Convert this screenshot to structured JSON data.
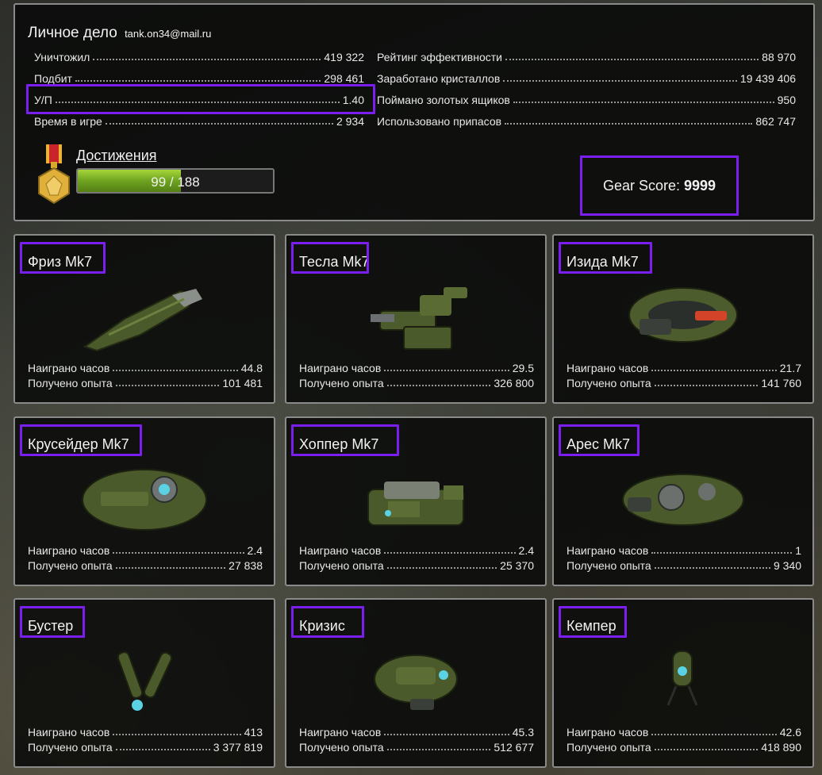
{
  "profile": {
    "title": "Личное дело",
    "email": "tank.on34@mail.ru",
    "left_stats": [
      {
        "label": "Уничтожил",
        "value": "419 322"
      },
      {
        "label": "Подбит",
        "value": "298 461"
      },
      {
        "label": "У/П",
        "value": "1.40"
      },
      {
        "label": "Время в игре",
        "value": "2 934"
      }
    ],
    "right_stats": [
      {
        "label": "Рейтинг эффективности",
        "value": "88 970"
      },
      {
        "label": "Заработано кристаллов",
        "value": "19 439 406"
      },
      {
        "label": "Поймано золотых ящиков",
        "value": "950"
      },
      {
        "label": "Использовано припасов",
        "value": "862 747"
      }
    ],
    "achievements": {
      "label": "Достижения",
      "progress_text": "99 / 188",
      "progress_fraction": 0.527
    },
    "gear_score": {
      "label": "Gear Score:",
      "value": "9999"
    }
  },
  "cards": [
    {
      "name": "Фриз Mk7",
      "hours_label": "Наиграно часов",
      "hours": "44.8",
      "xp_label": "Получено опыта",
      "xp": "101 481",
      "icon": "freeze-turret-icon"
    },
    {
      "name": "Тесла Mk7",
      "hours_label": "Наиграно часов",
      "hours": "29.5",
      "xp_label": "Получено опыта",
      "xp": "326 800",
      "icon": "tesla-turret-icon"
    },
    {
      "name": "Изида Mk7",
      "hours_label": "Наиграно часов",
      "hours": "21.7",
      "xp_label": "Получено опыта",
      "xp": "141 760",
      "icon": "isida-turret-icon"
    },
    {
      "name": "Крусейдер Mk7",
      "hours_label": "Наиграно часов",
      "hours": "2.4",
      "xp_label": "Получено опыта",
      "xp": "27 838",
      "icon": "crusader-hull-icon"
    },
    {
      "name": "Хоппер Mk7",
      "hours_label": "Наиграно часов",
      "hours": "2.4",
      "xp_label": "Получено опыта",
      "xp": "25 370",
      "icon": "hopper-hull-icon"
    },
    {
      "name": "Арес Mk7",
      "hours_label": "Наиграно часов",
      "hours": "1",
      "xp_label": "Получено опыта",
      "xp": "9 340",
      "icon": "ares-hull-icon"
    },
    {
      "name": "Бустер",
      "hours_label": "Наиграно часов",
      "hours": "413",
      "xp_label": "Получено опыта",
      "xp": "3 377 819",
      "icon": "booster-drone-icon"
    },
    {
      "name": "Кризис",
      "hours_label": "Наиграно часов",
      "hours": "45.3",
      "xp_label": "Получено опыта",
      "xp": "512 677",
      "icon": "crisis-drone-icon"
    },
    {
      "name": "Кемпер",
      "hours_label": "Наиграно часов",
      "hours": "42.6",
      "xp_label": "Получено опыта",
      "xp": "418 890",
      "icon": "camper-drone-icon"
    }
  ],
  "colors": {
    "highlight": "#7b1ff0",
    "progress": "#7bb326",
    "panel_border": "#8a8a8a"
  }
}
